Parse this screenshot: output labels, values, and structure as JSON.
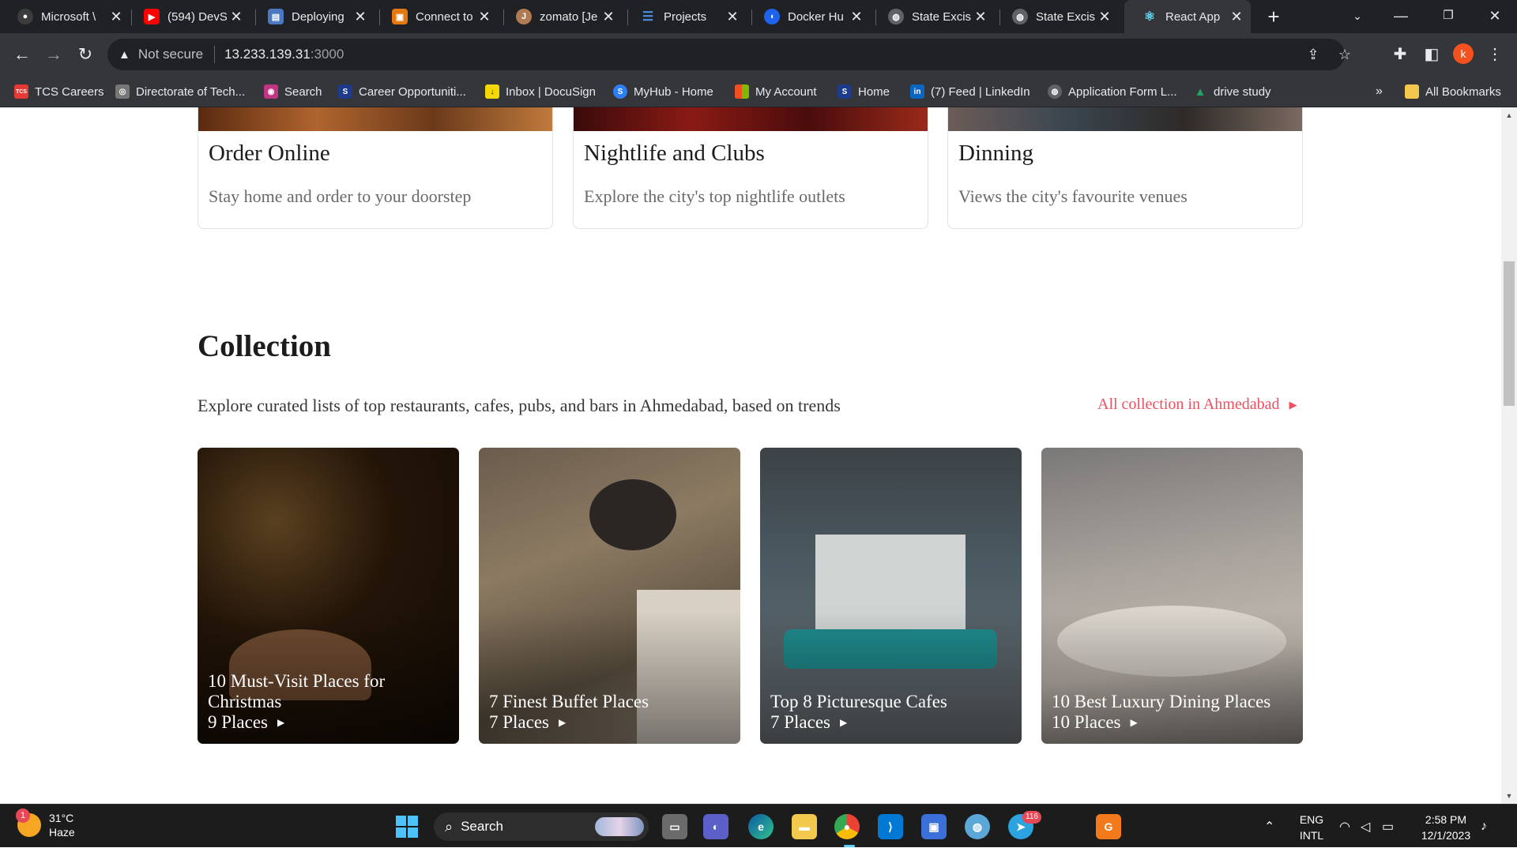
{
  "browser": {
    "tabs": [
      {
        "title": "Microsoft \\",
        "icon": "github-icon",
        "color": "#3c3c3c"
      },
      {
        "title": "(594) DevS",
        "icon": "youtube-icon",
        "color": "#ff0000"
      },
      {
        "title": "Deploying",
        "icon": "page-icon",
        "color": "#4a78c2"
      },
      {
        "title": "Connect to",
        "icon": "aws-icon",
        "color": "#e47911"
      },
      {
        "title": "zomato [Je",
        "icon": "jenkins-icon",
        "color": "#b07a52"
      },
      {
        "title": "Projects",
        "icon": "projects-icon",
        "color": "#4a90e2"
      },
      {
        "title": "Docker Hu",
        "icon": "docker-icon",
        "color": "#1d63ed"
      },
      {
        "title": "State Excis",
        "icon": "globe-icon",
        "color": "#5f6368"
      },
      {
        "title": "State Excis",
        "icon": "globe-icon",
        "color": "#5f6368"
      },
      {
        "title": "React App",
        "icon": "react-icon",
        "color": "#61dafb"
      }
    ],
    "address": {
      "warning": "Not secure",
      "host": "13.233.139.31",
      "port": ":3000"
    },
    "profile_initial": "k",
    "bookmarks": [
      {
        "label": "TCS Careers",
        "color": "#e53935",
        "glyph": "TCS"
      },
      {
        "label": "Directorate of Tech...",
        "color": "#777777",
        "glyph": "◎"
      },
      {
        "label": "Search",
        "color": "#c13584",
        "glyph": "◉"
      },
      {
        "label": "Career Opportuniti...",
        "color": "#1e3a8a",
        "glyph": "S"
      },
      {
        "label": "Inbox | DocuSign",
        "color": "#f5d800",
        "glyph": "↓"
      },
      {
        "label": "MyHub - Home",
        "color": "#2d7ff9",
        "glyph": "S"
      },
      {
        "label": "My Account",
        "color": "#f25022",
        "glyph": "▦"
      },
      {
        "label": "Home",
        "color": "#1e3a8a",
        "glyph": "S"
      },
      {
        "label": "(7) Feed | LinkedIn",
        "color": "#0a66c2",
        "glyph": "in"
      },
      {
        "label": "Application Form L...",
        "color": "#5f6368",
        "glyph": "◍"
      },
      {
        "label": "drive study",
        "color": "#1fa463",
        "glyph": "▲"
      }
    ],
    "more_bookmarks": "»",
    "all_bookmarks": "All Bookmarks"
  },
  "page": {
    "top_cards": [
      {
        "title": "Order Online",
        "desc": "Stay home and order to your doorstep",
        "img_color": "#7a3b1a"
      },
      {
        "title": "Nightlife and Clubs",
        "desc": "Explore the city's top nightlife outlets",
        "img_color": "#6b1414"
      },
      {
        "title": "Dinning",
        "desc": "Views the city's favourite venues",
        "img_color": "#4b4746"
      }
    ],
    "collection": {
      "title": "Collection",
      "desc": "Explore curated lists of top restaurants, cafes, pubs, and bars in Ahmedabad, based on trends",
      "link": "All collection in Ahmedabad",
      "cards": [
        {
          "title": "10 Must-Visit Places for Christmas",
          "places": "9 Places",
          "bg": "#2a1a10"
        },
        {
          "title": "7 Finest Buffet Places",
          "places": "7 Places",
          "bg": "#8a7a66"
        },
        {
          "title": "Top 8 Picturesque Cafes",
          "places": "7 Places",
          "bg": "#4d5a60"
        },
        {
          "title": "10 Best Luxury Dining Places",
          "places": "10 Places",
          "bg": "#a79d95"
        }
      ]
    }
  },
  "taskbar": {
    "weather_temp": "31°C",
    "weather_desc": "Haze",
    "weather_badge": "1",
    "search_label": "Search",
    "language": "ENG",
    "layout": "INTL",
    "time": "2:58 PM",
    "date": "12/1/2023",
    "telegram_badge": "116"
  }
}
